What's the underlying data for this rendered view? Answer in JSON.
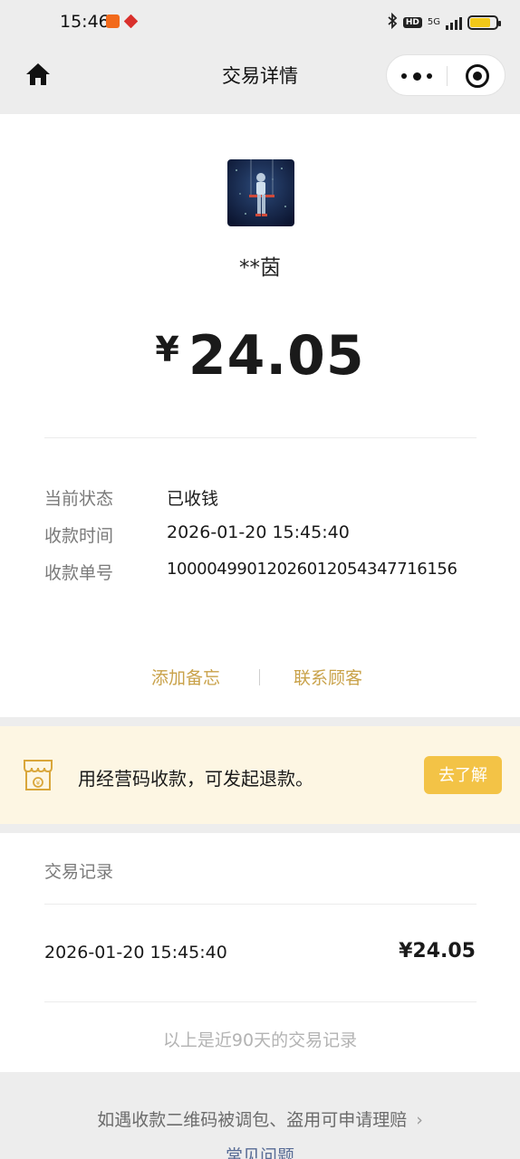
{
  "status_bar": {
    "time": "15:46",
    "network": "5G",
    "hd": "HD",
    "battery_level": 0.8,
    "battery_color": "#f2c818"
  },
  "nav": {
    "title": "交易详情",
    "home_icon": "home-icon",
    "more_icon": "more-dots-icon",
    "close_icon": "target-close-icon"
  },
  "payer": {
    "name": "**茵"
  },
  "amount": {
    "currency": "¥",
    "value": "24.05"
  },
  "details": [
    {
      "label": "当前状态",
      "value": "已收钱"
    },
    {
      "label": "收款时间",
      "value": "2026-01-20 15:45:40"
    },
    {
      "label": "收款单号",
      "value": "100004990120260120543477 16156"
    }
  ],
  "actions": {
    "add_note": "添加备忘",
    "contact_customer": "联系顾客"
  },
  "banner": {
    "text": "用经营码收款，可发起退款。",
    "button": "去了解"
  },
  "records": {
    "title": "交易记录",
    "items": [
      {
        "time": "2026-01-20 15:45:40",
        "amount": "¥24.05"
      }
    ],
    "footnote": "以上是近90天的交易记录"
  },
  "bottom": {
    "claim_text": "如遇收款二维码被调包、盗用可申请理赔",
    "claim_chevron": "›",
    "faq": "常见问题"
  },
  "colors": {
    "accent_gold": "#c9a24a",
    "banner_bg": "#fdf6e3",
    "button_yellow": "#f3c346",
    "link_blue": "#576b95"
  }
}
